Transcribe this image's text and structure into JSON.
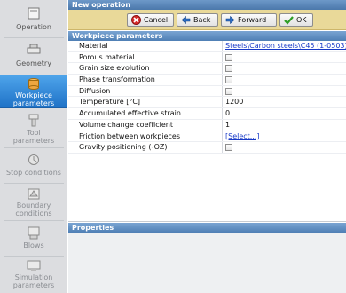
{
  "sidebar": {
    "items": [
      {
        "line1": "Operation",
        "line2": "",
        "icon": "operation-icon",
        "state": "normal"
      },
      {
        "line1": "Geometry",
        "line2": "",
        "icon": "geometry-icon",
        "state": "normal"
      },
      {
        "line1": "Workpiece",
        "line2": "parameters",
        "icon": "workpiece-icon",
        "state": "active"
      },
      {
        "line1": "Tool",
        "line2": "parameters",
        "icon": "tool-icon",
        "state": "disabled"
      },
      {
        "line1": "Stop conditions",
        "line2": "",
        "icon": "stop-conditions-icon",
        "state": "disabled"
      },
      {
        "line1": "Boundary",
        "line2": "conditions",
        "icon": "boundary-icon",
        "state": "disabled"
      },
      {
        "line1": "Blows",
        "line2": "",
        "icon": "blows-icon",
        "state": "disabled"
      },
      {
        "line1": "Simulation",
        "line2": "parameters",
        "icon": "simulation-icon",
        "state": "disabled"
      }
    ]
  },
  "header": {
    "title": "New operation"
  },
  "toolbar": {
    "cancel_label": "Cancel",
    "back_label": "Back",
    "forward_label": "Forward",
    "ok_label": "OK"
  },
  "workpiece": {
    "section_title": "Workpiece parameters",
    "rows": [
      {
        "label": "Material",
        "type": "link",
        "value": "Steels\\Carbon steels\\C45 (1-0503)"
      },
      {
        "label": "Porous material",
        "type": "checkbox",
        "value": ""
      },
      {
        "label": "Grain size evolution",
        "type": "checkbox",
        "value": ""
      },
      {
        "label": "Phase transformation",
        "type": "checkbox",
        "value": ""
      },
      {
        "label": "Diffusion",
        "type": "checkbox",
        "value": ""
      },
      {
        "label": "Temperature [°C]",
        "type": "text",
        "value": "1200"
      },
      {
        "label": "Accumulated effective strain",
        "type": "text",
        "value": "0"
      },
      {
        "label": "Volume change coefficient",
        "type": "text",
        "value": "1"
      },
      {
        "label": "Friction between workpieces",
        "type": "link",
        "value": "[Select...]"
      },
      {
        "label": "Gravity positioning (-OZ)",
        "type": "checkbox",
        "value": ""
      }
    ]
  },
  "properties": {
    "section_title": "Properties"
  },
  "colors": {
    "toolbar_bg": "#e9d999",
    "section_head": "#5a88bf",
    "active_item": "#2f86d8",
    "link": "#1739c7"
  }
}
